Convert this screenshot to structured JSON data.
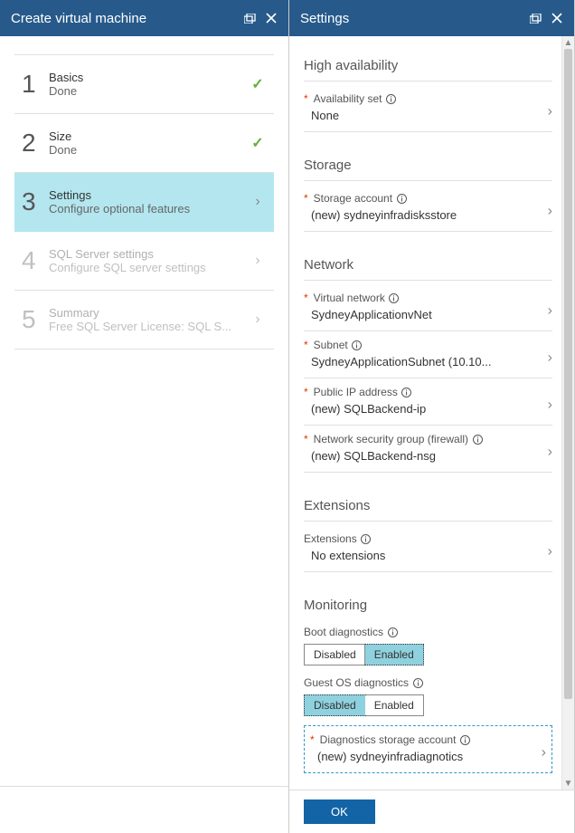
{
  "leftPanel": {
    "title": "Create virtual machine",
    "steps": [
      {
        "num": "1",
        "title": "Basics",
        "sub": "Done",
        "status": "done"
      },
      {
        "num": "2",
        "title": "Size",
        "sub": "Done",
        "status": "done"
      },
      {
        "num": "3",
        "title": "Settings",
        "sub": "Configure optional features",
        "status": "active"
      },
      {
        "num": "4",
        "title": "SQL Server settings",
        "sub": "Configure SQL server settings",
        "status": "disabled"
      },
      {
        "num": "5",
        "title": "Summary",
        "sub": "Free SQL Server License: SQL S...",
        "status": "disabled"
      }
    ]
  },
  "rightPanel": {
    "title": "Settings",
    "highAvailability": {
      "heading": "High availability",
      "availabilitySet": {
        "label": "Availability set",
        "value": "None"
      }
    },
    "storage": {
      "heading": "Storage",
      "storageAccount": {
        "label": "Storage account",
        "value": "(new) sydneyinfradisksstore"
      }
    },
    "network": {
      "heading": "Network",
      "virtualNetwork": {
        "label": "Virtual network",
        "value": "SydneyApplicationvNet"
      },
      "subnet": {
        "label": "Subnet",
        "value": "SydneyApplicationSubnet (10.10..."
      },
      "publicIp": {
        "label": "Public IP address",
        "value": "(new) SQLBackend-ip"
      },
      "nsg": {
        "label": "Network security group (firewall)",
        "value": "(new) SQLBackend-nsg"
      }
    },
    "extensions": {
      "heading": "Extensions",
      "ext": {
        "label": "Extensions",
        "value": "No extensions"
      }
    },
    "monitoring": {
      "heading": "Monitoring",
      "bootDiag": {
        "label": "Boot diagnostics",
        "disabled": "Disabled",
        "enabled": "Enabled",
        "selected": "enabled"
      },
      "guestDiag": {
        "label": "Guest OS diagnostics",
        "disabled": "Disabled",
        "enabled": "Enabled",
        "selected": "disabled"
      },
      "diagStorage": {
        "label": "Diagnostics storage account",
        "value": "(new) sydneyinfradiagnotics"
      }
    },
    "okLabel": "OK"
  }
}
